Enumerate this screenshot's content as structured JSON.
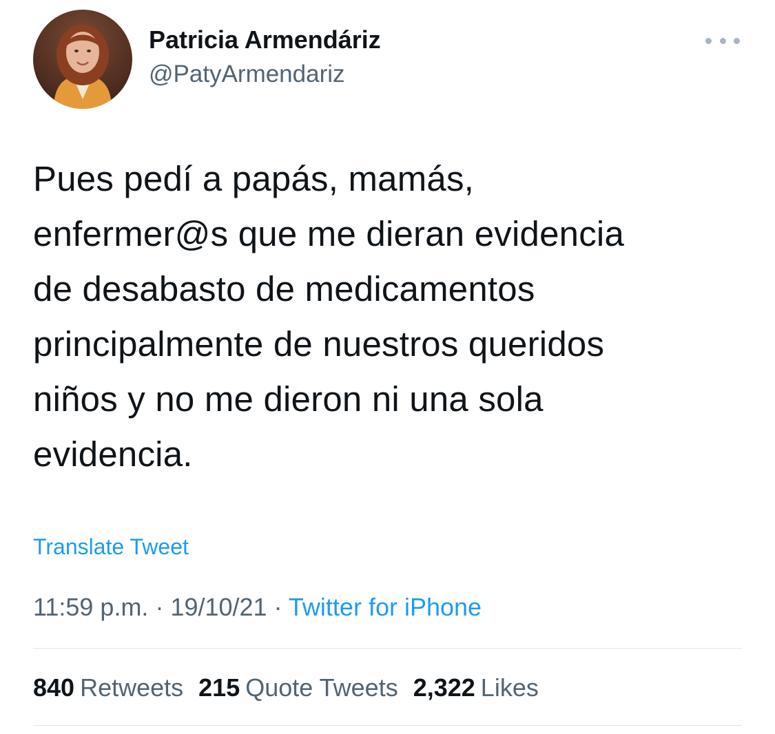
{
  "author": {
    "name": "Patricia Armendáriz",
    "handle": "@PatyArmendariz"
  },
  "tweet": {
    "text": "Pues pedí a papás, mamás,\nenfermer@s que me dieran evidencia\nde desabasto de medicamentos\nprincipalmente de nuestros queridos\nniños y no me dieron ni una sola\nevidencia.",
    "translate_label": "Translate Tweet",
    "time": "11:59 p.m.",
    "date": "19/10/21",
    "separator": " · ",
    "source": "Twitter for iPhone"
  },
  "stats": {
    "retweets_count": "840",
    "retweets_label": "Retweets",
    "quotes_count": "215",
    "quotes_label": "Quote Tweets",
    "likes_count": "2,322",
    "likes_label": "Likes"
  },
  "icons": {
    "more": "more-options-icon"
  },
  "colors": {
    "link": "#1d9bf0",
    "secondary_text": "#536471",
    "primary_text": "#0f1419",
    "divider": "#e1e6ea"
  }
}
